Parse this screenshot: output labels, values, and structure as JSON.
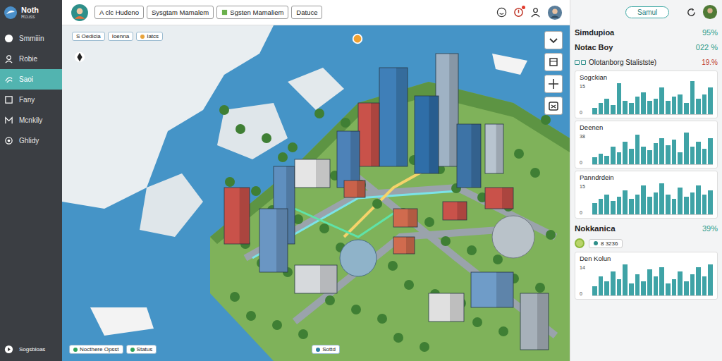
{
  "app": {
    "logo": "Noth",
    "logo_sub": "Rcuss"
  },
  "sidebar": {
    "items": [
      {
        "label": "Smmiiin",
        "selected": false
      },
      {
        "label": "Robie",
        "selected": false
      },
      {
        "label": "Saoi",
        "selected": true
      },
      {
        "label": "Fany",
        "selected": false
      },
      {
        "label": "Mcnkily",
        "selected": false
      },
      {
        "label": "Ghlidy",
        "selected": false
      }
    ],
    "footer": "Sogsbloas"
  },
  "tabs": [
    {
      "label": "A clc Hudeno",
      "selected": false
    },
    {
      "label": "Sysgtam Mamalem",
      "selected": false
    },
    {
      "label": "Sgsten Mamaliem",
      "selected": false
    },
    {
      "label": "Datuce",
      "selected": false
    }
  ],
  "map": {
    "labels": [
      "S Oedicia",
      "Ioenna",
      "Iatcs"
    ],
    "bottom_pills": [
      "Nocthere Opsst",
      "Status"
    ],
    "center_pill": "Sottd"
  },
  "panel": {
    "button": "Samul",
    "stats": [
      {
        "label": "Simdupioa",
        "value": "95%"
      },
      {
        "label": "Notac Boy",
        "value": "022 %"
      }
    ],
    "section": {
      "title": "Olotanborg Stalistste)",
      "value": "19.%"
    },
    "charts": [
      {
        "title": "Sogckian",
        "ticks": [
          "15",
          "0"
        ],
        "values": [
          3,
          5,
          7,
          4,
          14,
          6,
          5,
          8,
          10,
          6,
          7,
          12,
          6,
          8,
          9,
          5,
          15,
          7,
          9,
          12
        ]
      },
      {
        "title": "Deenen",
        "ticks": [
          "38",
          "0"
        ],
        "values": [
          8,
          12,
          10,
          20,
          14,
          26,
          18,
          34,
          20,
          16,
          24,
          30,
          22,
          28,
          14,
          36,
          20,
          26,
          18,
          30
        ]
      },
      {
        "title": "Panndrdein",
        "ticks": [
          "15",
          "0"
        ],
        "values": [
          5,
          7,
          9,
          6,
          8,
          11,
          7,
          9,
          13,
          8,
          10,
          14,
          9,
          7,
          12,
          8,
          10,
          13,
          9,
          11
        ]
      }
    ],
    "highlight": {
      "label": "Nokkanica",
      "value": "39%",
      "sub": "8 3236"
    },
    "chart_bottom": {
      "title": "Den Kolun",
      "ticks": [
        "14",
        "0"
      ],
      "values": [
        4,
        8,
        6,
        10,
        7,
        13,
        5,
        9,
        6,
        11,
        8,
        12,
        5,
        7,
        10,
        6,
        9,
        12,
        8,
        13
      ]
    }
  }
}
